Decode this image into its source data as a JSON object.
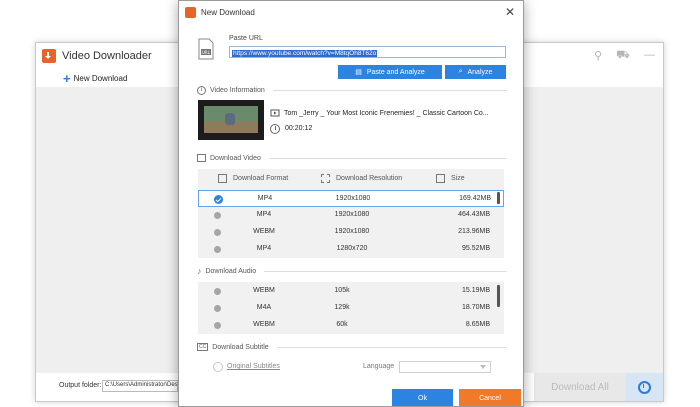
{
  "main_window": {
    "title": "Video Downloader",
    "new_download": "New Download",
    "output_label": "Output folder:",
    "output_path": "C:\\Users\\Administrator\\Desk",
    "download_all": "Download All"
  },
  "dialog": {
    "title": "New Download",
    "paste_url_label": "Paste URL",
    "url_value": "https://www.youtube.com/watch?v=M8tqOh8T62o",
    "paste_analyze_label": "Paste and Analyze",
    "analyze_label": "Analyze",
    "video_info_heading": "Video Information",
    "video_title": "Tom _Jerry _ Your Most Iconic Frenemies! _ Classic Cartoon Co...",
    "video_duration": "00:20:12",
    "download_video_heading": "Download Video",
    "video_columns": [
      "Download Format",
      "Download Resolution",
      "Size"
    ],
    "video_rows": [
      {
        "format": "MP4",
        "resolution": "1920x1080",
        "size": "169.42MB"
      },
      {
        "format": "MP4",
        "resolution": "1920x1080",
        "size": "464.43MB"
      },
      {
        "format": "WEBM",
        "resolution": "1920x1080",
        "size": "213.96MB"
      },
      {
        "format": "MP4",
        "resolution": "1280x720",
        "size": "95.52MB"
      }
    ],
    "download_audio_heading": "Download Audio",
    "audio_rows": [
      {
        "format": "WEBM",
        "bitrate": "105k",
        "size": "15.19MB"
      },
      {
        "format": "M4A",
        "bitrate": "129k",
        "size": "18.70MB"
      },
      {
        "format": "WEBM",
        "bitrate": "60k",
        "size": "8.65MB"
      }
    ],
    "download_subtitle_heading": "Download Subtitle",
    "original_subtitles": "Original Subtitles",
    "language_label": "Language",
    "language_value": "",
    "ok_label": "Ok",
    "cancel_label": "Cancel"
  },
  "colors": {
    "accent_blue": "#2d84e0",
    "cancel_orange": "#f07a2a",
    "brand_orange": "#e8632b"
  }
}
